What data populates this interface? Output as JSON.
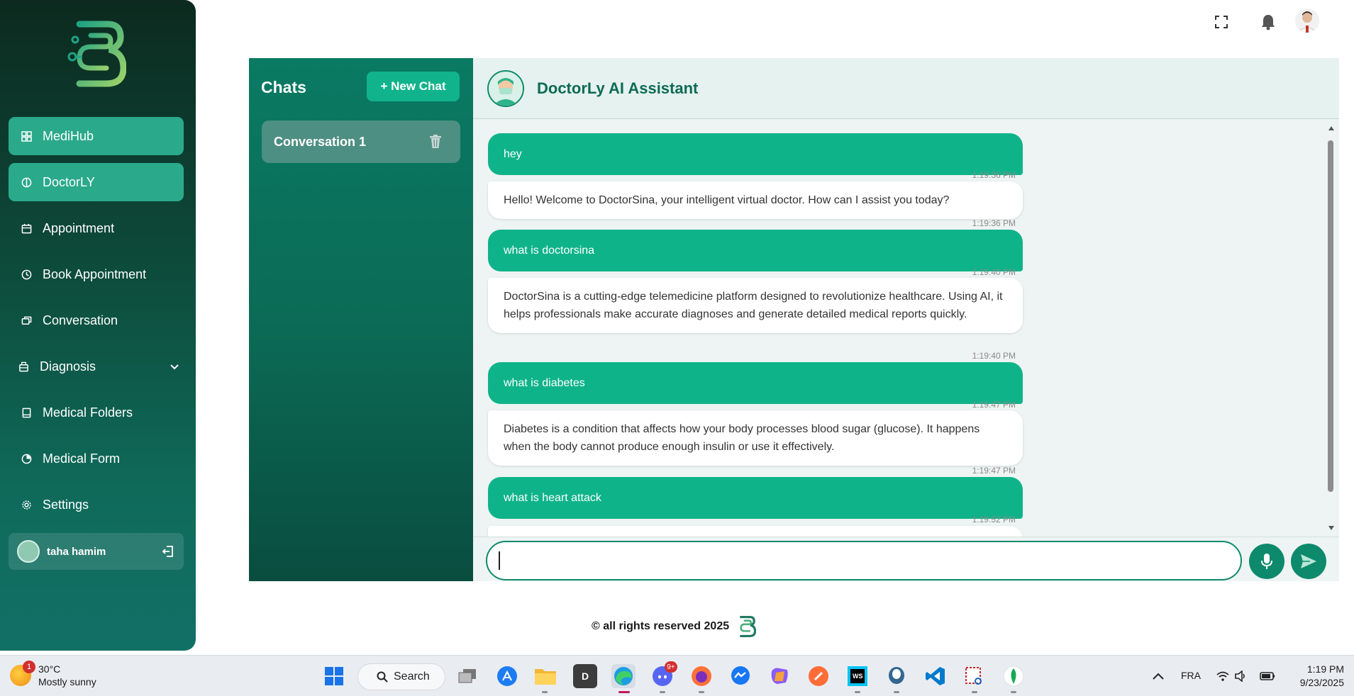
{
  "sidebar": {
    "items": [
      {
        "label": "MediHub",
        "icon": "grid-icon",
        "active": true
      },
      {
        "label": "DoctorLY",
        "icon": "doctorly-icon",
        "active": true
      },
      {
        "label": "Appointment",
        "icon": "calendar-icon",
        "active": false
      },
      {
        "label": "Book Appointment",
        "icon": "clock-icon",
        "active": false
      },
      {
        "label": "Conversation",
        "icon": "chat-icon",
        "active": false
      },
      {
        "label": "Diagnosis",
        "icon": "diagnosis-icon",
        "active": false
      },
      {
        "label": "Medical Folders",
        "icon": "book-icon",
        "active": false
      },
      {
        "label": "Medical Form",
        "icon": "form-icon",
        "active": false
      },
      {
        "label": "Settings",
        "icon": "gear-icon",
        "active": false
      }
    ],
    "user": {
      "name": "taha hamim"
    }
  },
  "chats": {
    "title": "Chats",
    "new_chat_label": "+ New Chat",
    "conversations": [
      {
        "label": "Conversation 1"
      }
    ]
  },
  "chat": {
    "title": "DoctorLy AI Assistant",
    "messages": [
      {
        "role": "user",
        "text": "hey",
        "time": "1:19:36 PM"
      },
      {
        "role": "bot",
        "text": "Hello! Welcome to DoctorSina, your intelligent virtual doctor. How can I assist you today?",
        "time": "1:19:36 PM"
      },
      {
        "role": "user",
        "text": "what is doctorsina",
        "time": "1:19:40 PM"
      },
      {
        "role": "bot",
        "text": "DoctorSina is a cutting-edge telemedicine platform designed to revolutionize healthcare. Using AI, it helps professionals make accurate diagnoses and generate detailed medical reports quickly.",
        "time": "1:19:40 PM"
      },
      {
        "role": "user",
        "text": "what is diabetes",
        "time": "1:19:47 PM"
      },
      {
        "role": "bot",
        "text": "Diabetes is a condition that affects how your body processes blood sugar (glucose). It happens when the body cannot produce enough insulin or use it effectively.",
        "time": "1:19:47 PM"
      },
      {
        "role": "user",
        "text": "what is heart attack",
        "time": "1:19:52 PM"
      }
    ],
    "input_value": ""
  },
  "footer": {
    "text": "© all rights reserved 2025"
  },
  "taskbar": {
    "weather": {
      "temp": "30°C",
      "condition": "Mostly sunny",
      "badge": "1"
    },
    "search_label": "Search",
    "discord_badge": "9+",
    "tray": {
      "lang": "FRA"
    },
    "clock": {
      "time": "1:19 PM",
      "date": "9/23/2025"
    }
  },
  "colors": {
    "accent": "#0fb38a",
    "sidebar_dark": "#0c2a1f",
    "header_text": "#0d6b52"
  }
}
